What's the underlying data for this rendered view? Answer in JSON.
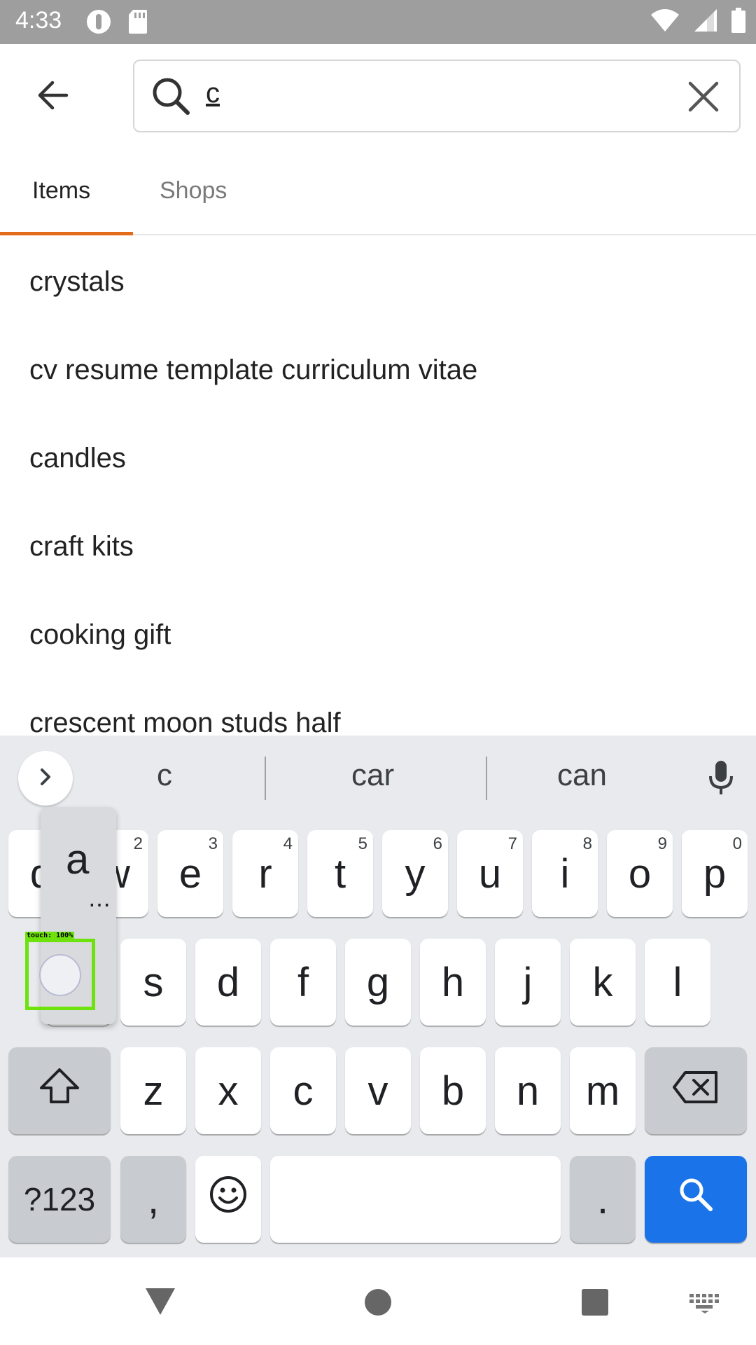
{
  "status_bar": {
    "time": "4:33",
    "icons": [
      "account-circle-icon",
      "sd-card-icon",
      "wifi-icon",
      "cell-signal-icon",
      "battery-icon"
    ]
  },
  "header": {
    "back_icon": "arrow-back-icon",
    "search": {
      "value": "c",
      "search_icon": "search-icon",
      "clear_icon": "close-icon"
    }
  },
  "tabs": [
    {
      "label": "Items",
      "active": true
    },
    {
      "label": "Shops",
      "active": false
    }
  ],
  "suggestions": [
    "crystals",
    "cv resume template curriculum vitae",
    "candles",
    "craft kits",
    "cooking gift",
    "crescent moon studs half"
  ],
  "keyboard": {
    "suggestions": [
      "c",
      "car",
      "can"
    ],
    "rows": [
      [
        {
          "label": "q",
          "hint": "1"
        },
        {
          "label": "w",
          "hint": "2"
        },
        {
          "label": "e",
          "hint": "3"
        },
        {
          "label": "r",
          "hint": "4"
        },
        {
          "label": "t",
          "hint": "5"
        },
        {
          "label": "y",
          "hint": "6"
        },
        {
          "label": "u",
          "hint": "7"
        },
        {
          "label": "i",
          "hint": "8"
        },
        {
          "label": "o",
          "hint": "9"
        },
        {
          "label": "p",
          "hint": "0"
        }
      ],
      [
        {
          "label": "a"
        },
        {
          "label": "s"
        },
        {
          "label": "d"
        },
        {
          "label": "f"
        },
        {
          "label": "g"
        },
        {
          "label": "h"
        },
        {
          "label": "j"
        },
        {
          "label": "k"
        },
        {
          "label": "l"
        }
      ],
      [
        {
          "label": "z"
        },
        {
          "label": "x"
        },
        {
          "label": "c"
        },
        {
          "label": "v"
        },
        {
          "label": "b"
        },
        {
          "label": "n"
        },
        {
          "label": "m"
        }
      ]
    ],
    "symbols_label": "?123",
    "comma_label": ",",
    "period_label": ".",
    "popup": {
      "letter": "a",
      "more": "…"
    },
    "touch_label": "touch: 100%",
    "accent_color": "#1a73e8"
  },
  "nav_bar": {
    "icons": [
      "back-triangle-icon",
      "home-circle-icon",
      "recents-square-icon",
      "keyboard-switch-icon"
    ]
  },
  "colors": {
    "tab_indicator": "#e36b1a",
    "status_bar": "#9e9e9e",
    "touch_highlight": "#6ee20d"
  }
}
